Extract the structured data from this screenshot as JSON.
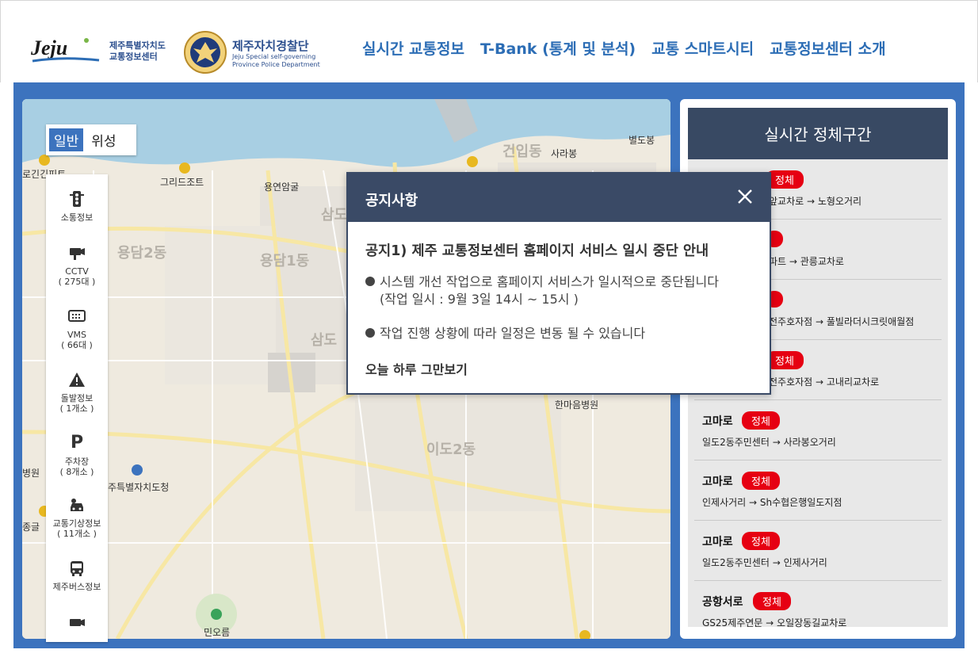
{
  "header": {
    "logo_text_line1": "제주특별자치도",
    "logo_text_line2": "교통정보센터",
    "police_title": "제주자치경찰단",
    "police_sub_line1": "Jeju Special self-governing",
    "police_sub_line2": "Province Police Department",
    "nav": [
      "실시간 교통정보",
      "T-Bank (통계 및 분석)",
      "교통 스마트시티",
      "교통정보센터 소개"
    ]
  },
  "map": {
    "toggle": [
      "일반",
      "위성"
    ],
    "toggle_active": "일반",
    "tools": [
      {
        "label": "소통정보",
        "sub": "",
        "icon": "traffic-light-icon"
      },
      {
        "label": "CCTV",
        "sub": "( 275대 )",
        "icon": "cctv-icon"
      },
      {
        "label": "VMS",
        "sub": "( 66대 )",
        "icon": "vms-icon"
      },
      {
        "label": "돌발정보",
        "sub": "( 1개소 )",
        "icon": "warning-icon"
      },
      {
        "label": "주차장",
        "sub": "( 8개소 )",
        "icon": "parking-icon"
      },
      {
        "label": "교통기상정보",
        "sub": "( 11개소 )",
        "icon": "weather-car-icon"
      },
      {
        "label": "제주버스정보",
        "sub": "",
        "icon": "bus-icon"
      }
    ],
    "places": {
      "gunip": "건입동",
      "sarabong": "사라봉",
      "byeoldobong": "별도봉",
      "grilljot": "그리드조트",
      "yongyeonamgul": "용연암굴",
      "rogi": "로긴긴피트",
      "yongdam2": "용담2동",
      "yongdam1": "용담1동",
      "samdo": "삼도",
      "samdo2": "삼도",
      "ido2": "이도2동",
      "hanmaeum": "한마음병원",
      "byeongwon": "병원",
      "dochung": "주특별자치도청",
      "jonggul": "종글",
      "minoreum": "민오름"
    }
  },
  "panel": {
    "title": "실시간 정체구간",
    "items": [
      {
        "road": "",
        "status": "정체",
        "path": "앞교차로 → 노형오거리"
      },
      {
        "road": "",
        "status": "",
        "path": "파트 → 관릉교차로"
      },
      {
        "road": "",
        "status": "",
        "path": "전주호자점 → 풀빌라더시크릿애월점"
      },
      {
        "road": "",
        "status": "정체",
        "path": "전주호자점 → 고내리교차로"
      },
      {
        "road": "고마로",
        "status": "정체",
        "path": "일도2동주민센터 → 사라봉오거리"
      },
      {
        "road": "고마로",
        "status": "정체",
        "path": "인제사거리 → Sh수협은행일도지점"
      },
      {
        "road": "고마로",
        "status": "정체",
        "path": "일도2동주민센터 → 인제사거리"
      },
      {
        "road": "공항서로",
        "status": "정체",
        "path": "GS25제주연문 → 오일장동길교차로"
      }
    ]
  },
  "popup": {
    "title": "공지사항",
    "heading": "공지1) 제주 교통정보센터 홈페이지 서비스 일시 중단 안내",
    "item1_line1": "시스템 개선 작업으로 홈페이지 서비스가 일시적으로 중단됩니다",
    "item1_line2": "(작업 일시 : 9월 3일  14시  ~ 15시 )",
    "item2": "작업 진행 상황에 따라 일정은 변동 될 수 있습니다",
    "dismiss": "오늘 하루 그만보기"
  },
  "colors": {
    "brand_blue": "#3c73be",
    "nav_blue": "#2c6db5",
    "panel_header": "#384963",
    "jam_red": "#e60012"
  }
}
